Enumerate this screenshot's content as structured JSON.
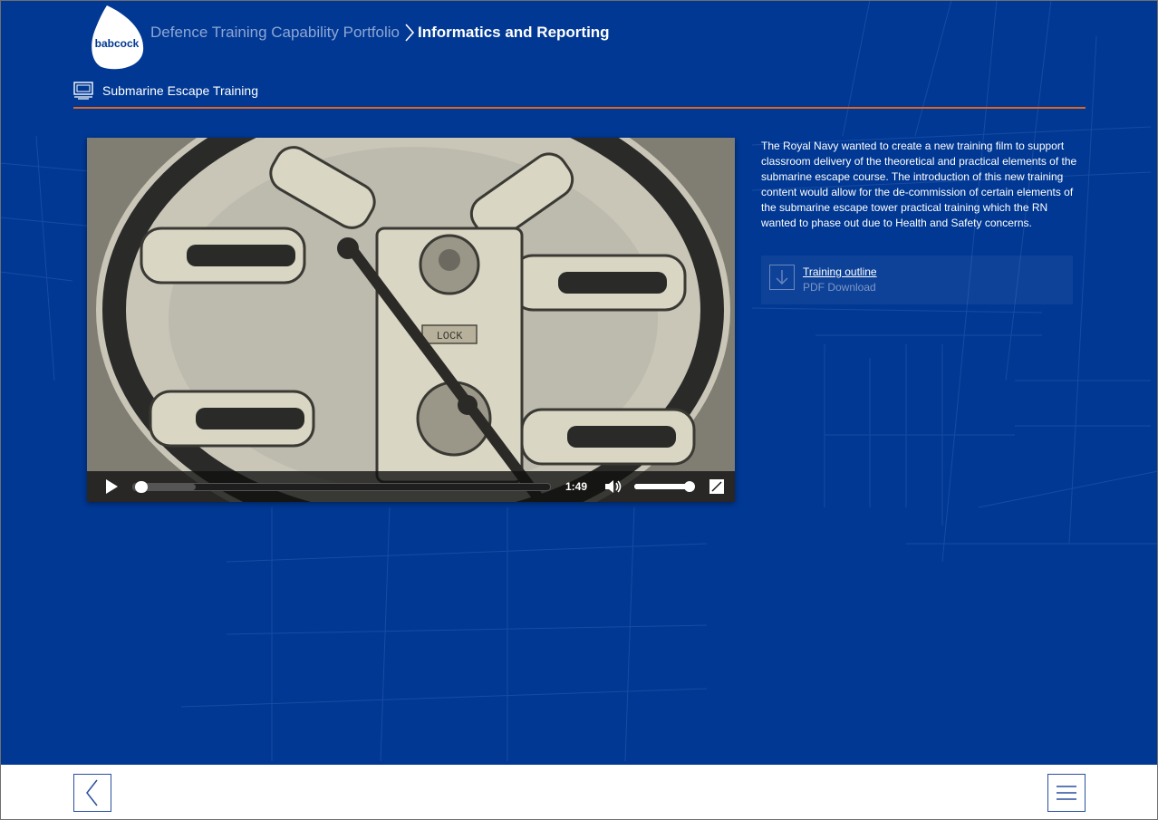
{
  "brand": {
    "logo_text": "babcock",
    "colors": {
      "background": "#003893",
      "accent_rule": "#e0651e",
      "muted_text": "#8ea6d4"
    }
  },
  "breadcrumb": {
    "root": "Defence Training Capability Portfolio",
    "current": "Informatics and Reporting",
    "separator_icon": "chevron-right-icon"
  },
  "section": {
    "icon": "monitor-icon",
    "title": "Submarine Escape Training"
  },
  "video": {
    "poster_subject": "submarine escape hatch locking mechanism",
    "plate_text": "LOCK",
    "time": "1:49",
    "progress_fraction": 0.02,
    "loaded_fraction": 0.15,
    "volume_fraction": 0.95,
    "icons": {
      "play": "play-icon",
      "volume": "volume-icon",
      "fullscreen": "fullscreen-icon"
    }
  },
  "description": "The Royal Navy wanted to create a new training film to support classroom delivery of the theoretical and practical elements of the submarine escape course. The introduction of this new training content would allow for the de-commission of certain elements of the submarine escape tower practical training which the RN wanted to phase out due to Health and Safety concerns.",
  "download": {
    "title": "Training outline",
    "subtitle": "PDF Download",
    "icon": "download-arrow-icon"
  },
  "footer": {
    "back_icon": "chevron-left-icon",
    "menu_icon": "hamburger-menu-icon"
  }
}
